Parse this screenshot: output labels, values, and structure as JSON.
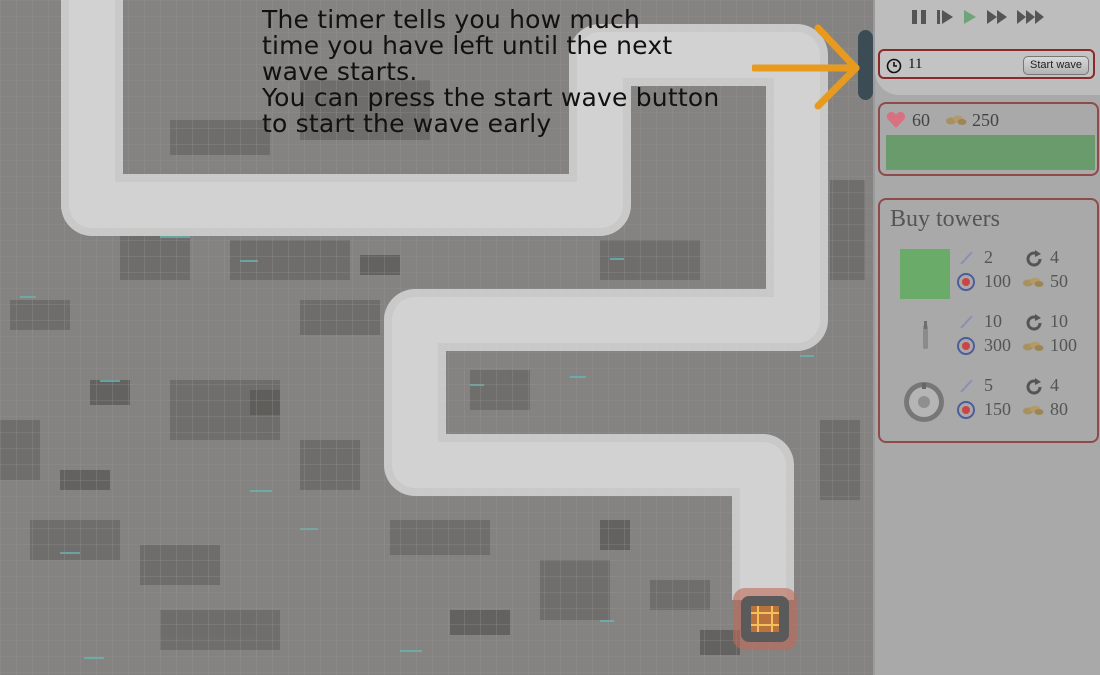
{
  "tutorial": {
    "lines": [
      "The timer tells you how much",
      "time you have left until the next",
      "wave starts.",
      "You can press the start wave button",
      "to start the wave early"
    ]
  },
  "controls": {
    "icons": [
      "pause-icon",
      "step-icon",
      "play-icon",
      "fast-forward-icon",
      "fastest-forward-icon"
    ],
    "active_color": "#6fa37a"
  },
  "timer": {
    "value": "11",
    "start_wave_label": "Start wave"
  },
  "status": {
    "lives": "60",
    "gold": "250",
    "health_fraction": 1.0,
    "lives_color": "#d9707f",
    "health_color": "#6a9b6c"
  },
  "shop": {
    "title": "Buy towers",
    "towers": [
      {
        "name": "green-block-tower",
        "damage": "2",
        "cooldown": "4",
        "range": "100",
        "cost": "50"
      },
      {
        "name": "needle-tower",
        "damage": "10",
        "cooldown": "10",
        "range": "300",
        "cost": "100"
      },
      {
        "name": "orb-tower",
        "damage": "5",
        "cooldown": "4",
        "range": "150",
        "cost": "80"
      }
    ]
  },
  "colors": {
    "panel_border": "#8f4a4a",
    "highlight_border": "#8b2a2a",
    "arrow": "#e89a1e",
    "path": "#cfcfcf"
  }
}
